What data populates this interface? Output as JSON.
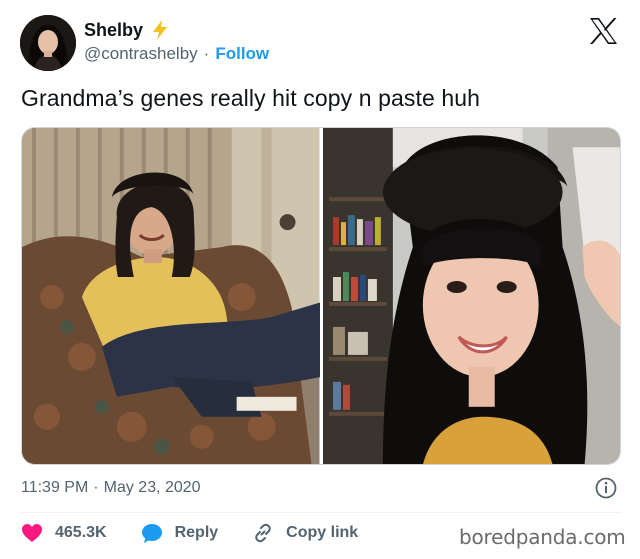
{
  "author": {
    "display_name": "Shelby",
    "handle": "@contrashelby",
    "separator": "·",
    "follow_label": "Follow"
  },
  "tweet": {
    "text": "Grandma’s genes really hit copy n paste huh"
  },
  "media": {
    "photos": [
      "vintage-photo",
      "selfie-photo"
    ]
  },
  "meta": {
    "time": "11:39 PM",
    "separator": "·",
    "date": "May 23, 2020"
  },
  "actions": {
    "likes": "465.3K",
    "reply_label": "Reply",
    "copy_link_label": "Copy link"
  },
  "watermark": "boredpanda.com",
  "colors": {
    "accent": "#1d9bf0",
    "like": "#f91880",
    "bolt": "#f4c11c",
    "secondary_text": "#536471"
  },
  "icons": [
    "bolt-icon",
    "x-logo-icon",
    "info-icon",
    "heart-icon",
    "reply-bubble-icon",
    "link-icon"
  ]
}
